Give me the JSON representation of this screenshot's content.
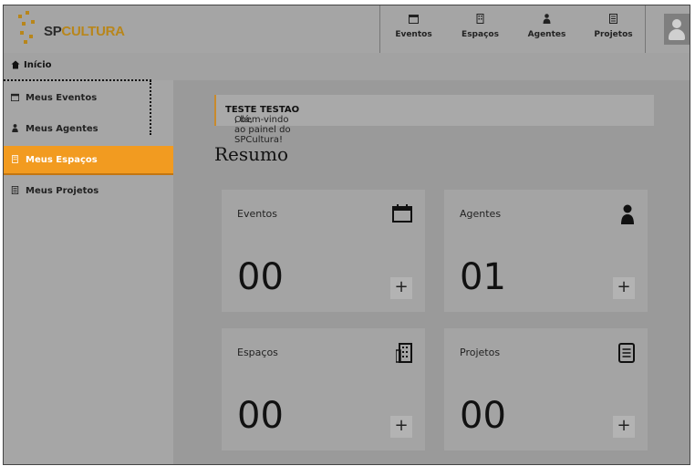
{
  "logo": {
    "sp": "SP",
    "cultura": "CULTURA",
    "color": "#b8861b"
  },
  "nav": [
    {
      "label": "Eventos",
      "icon": "calendar-icon"
    },
    {
      "label": "Espaços",
      "icon": "building-icon"
    },
    {
      "label": "Agentes",
      "icon": "person-icon"
    },
    {
      "label": "Projetos",
      "icon": "document-icon"
    }
  ],
  "inicio": {
    "label": "Início",
    "icon": "home-icon"
  },
  "sidebar": {
    "items": [
      {
        "label": "Meus Eventos",
        "icon": "calendar-icon"
      },
      {
        "label": "Meus Agentes",
        "icon": "person-icon"
      },
      {
        "label": "Meus Espaços",
        "icon": "building-icon",
        "active": true
      },
      {
        "label": "Meus Projetos",
        "icon": "document-icon"
      }
    ],
    "active_color": "#f29b20"
  },
  "welcome": {
    "prefix": "Olá, ",
    "name": "TESTE TESTAO",
    "suffix": ", bem-vindo ao painel do SPCultura!"
  },
  "summary": {
    "title": "Resumo",
    "cards": [
      {
        "title": "Eventos",
        "count": "00",
        "icon": "calendar-icon",
        "plus": "+"
      },
      {
        "title": "Agentes",
        "count": "01",
        "icon": "person-icon",
        "plus": "+"
      },
      {
        "title": "Espaços",
        "count": "00",
        "icon": "building-icon",
        "plus": "+"
      },
      {
        "title": "Projetos",
        "count": "00",
        "icon": "document-icon",
        "plus": "+"
      }
    ]
  }
}
